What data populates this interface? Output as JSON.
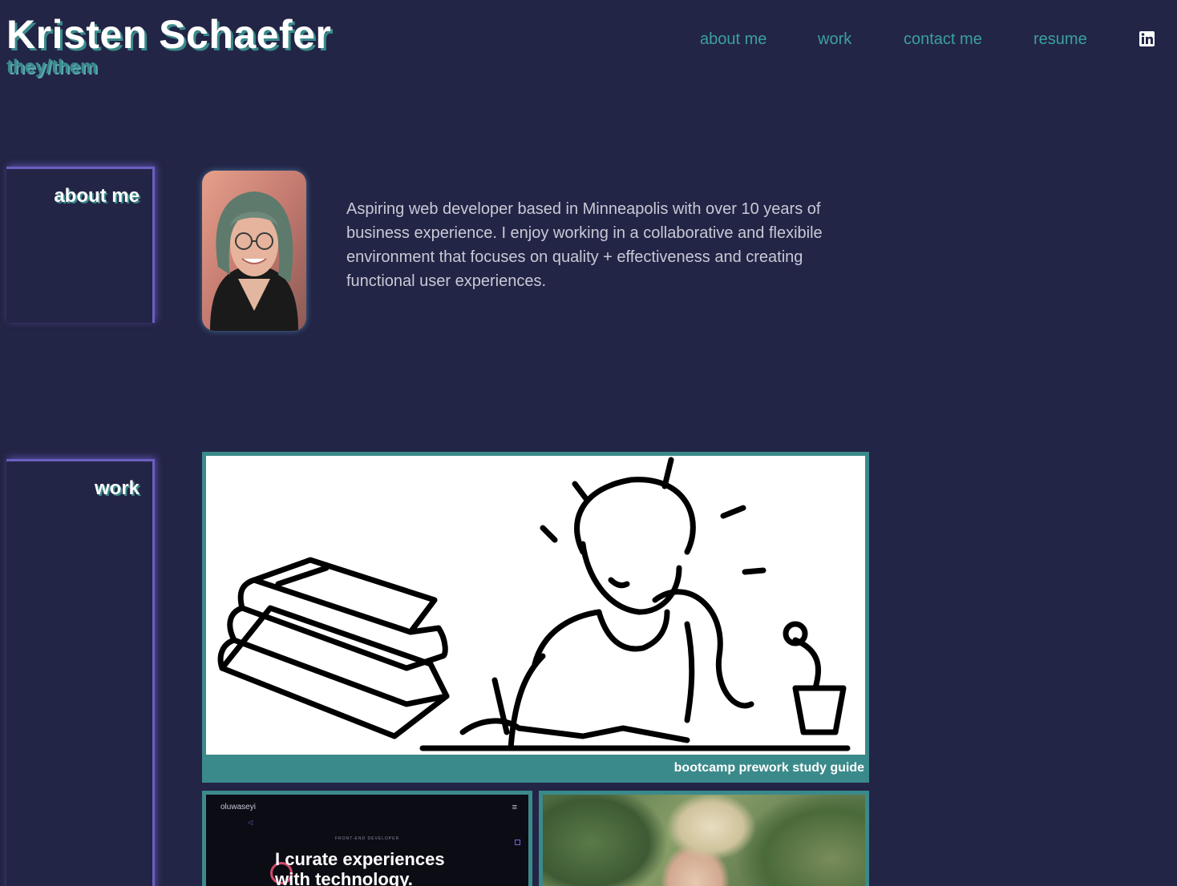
{
  "header": {
    "name": "Kristen Schaefer",
    "pronouns": "they/them",
    "nav": [
      {
        "label": "about me"
      },
      {
        "label": "work"
      },
      {
        "label": "contact me"
      },
      {
        "label": "resume"
      }
    ],
    "linkedin_icon": "linkedin-icon"
  },
  "about": {
    "heading": "about me",
    "photo_icon": "profile-photo",
    "text": "Aspiring web developer based in Minneapolis with over 10 years of business experience. I enjoy working in a collaborative and flexibile environment that focuses on quality + effectiveness and creating functional user experiences."
  },
  "work": {
    "heading": "work",
    "featured": {
      "caption": "bootcamp prework study guide"
    },
    "projects": [
      {
        "logo_text": "oluwaseyi",
        "menu_glyph": "≡",
        "subtitle": "FRONT-END DEVELOPER",
        "headline": "I curate experiences with technology."
      },
      {
        "image": "painting-thumbnail"
      }
    ]
  },
  "colors": {
    "background": "#232546",
    "accent_teal": "#3aa0a0",
    "accent_purple": "#6b5fc0",
    "card_teal": "#3b8a8b"
  }
}
